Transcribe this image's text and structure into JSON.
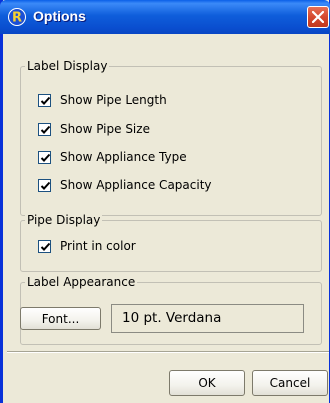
{
  "window": {
    "title": "Options",
    "accent": "#0831d9",
    "icon": "app-r-icon"
  },
  "label_display": {
    "title": "Label Display",
    "options": [
      {
        "label": "Show Pipe Length",
        "checked": true
      },
      {
        "label": "Show Pipe Size",
        "checked": true
      },
      {
        "label": "Show Appliance Type",
        "checked": true
      },
      {
        "label": "Show Appliance Capacity",
        "checked": true
      }
    ]
  },
  "pipe_display": {
    "title": "Pipe Display",
    "option": {
      "label": "Print in color",
      "checked": true
    }
  },
  "label_appearance": {
    "title": "Label Appearance",
    "font_button": "Font...",
    "font_value": "10 pt. Verdana"
  },
  "buttons": {
    "ok": "OK",
    "cancel": "Cancel"
  }
}
